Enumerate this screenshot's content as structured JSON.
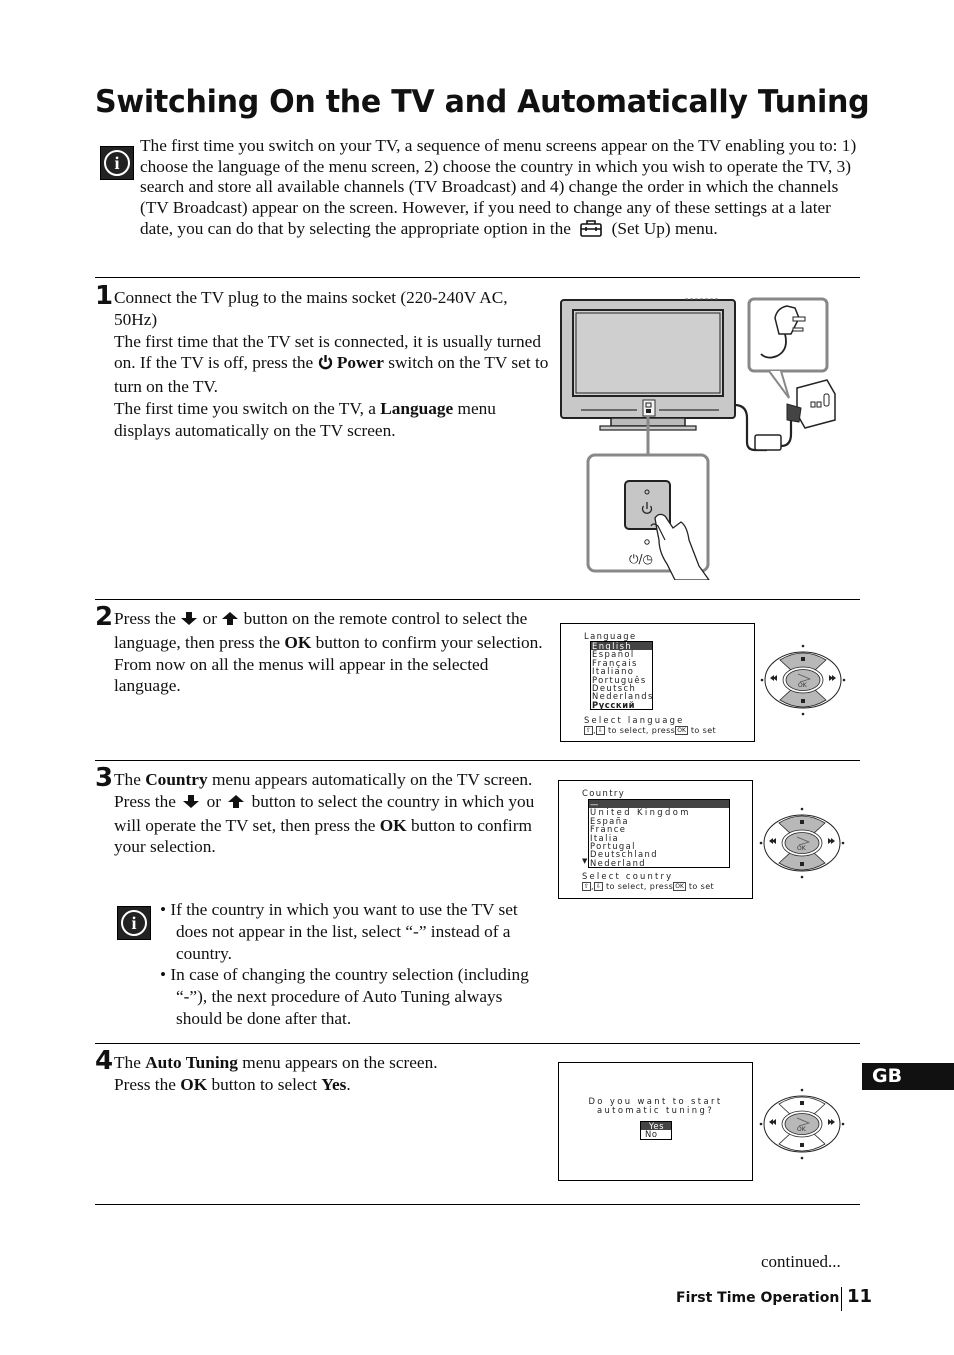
{
  "title": "Switching On the TV and Automatically Tuning",
  "intro": {
    "icon": "info-icon",
    "text_before_icon": "The first time you switch on your TV, a sequence of menu screens appear on the TV enabling you to: 1) choose the language of the menu screen, 2) choose the country in which you wish to operate the TV, 3) search and store all available channels (TV Broadcast) and 4) change the order in which the channels (TV Broadcast) appear on the screen. However, if you need to change any of these settings at a later date, you can do that by selecting the appropriate option in the",
    "setup_icon": "toolbox-icon",
    "text_after_icon": "(Set Up) menu."
  },
  "steps": [
    {
      "number": "1",
      "lines": {
        "a": "Connect the TV plug to the mains socket (220-240V AC, 50Hz)",
        "b1": "The first time that the TV set is connected, it is usually turned on. If the TV is off, press the",
        "b_bold": "Power",
        "b2": "switch on the TV set to turn on the TV.",
        "c1": "The first time you switch on the TV, a",
        "c_bold": "Language",
        "c2": "menu displays automatically on the TV screen."
      },
      "illustration": {
        "description": "TV set connected to mains socket, inset showing power switch being pressed",
        "standby_label": "⏻/◷"
      }
    },
    {
      "number": "2",
      "lines": {
        "a1": "Press the",
        "a_or": "or",
        "a2": "button on the remote control to select the language, then press the",
        "a_bold": "OK",
        "a3": "button to confirm your selection.",
        "b": "From now on all the menus will appear in the selected language."
      },
      "screen": {
        "heading": "Language",
        "options": [
          "English",
          "Español",
          "Français",
          "Italiano",
          "Português",
          "Deutsch",
          "Nederlands",
          "Русский"
        ],
        "selected_index": 0,
        "prompt": "Select language",
        "hint_mid": "to select, press",
        "hint_ok": "OK",
        "hint_end": "to set"
      },
      "remote_highlight": "up-down"
    },
    {
      "number": "3",
      "lines": {
        "a1": "The",
        "a_bold": "Country",
        "a2": "menu appears automatically on the TV screen.",
        "b1": "Press the",
        "b_or": "or",
        "b2": "button to select the country in which you will operate the TV set, then press the",
        "b_bold": "OK",
        "b3": "button to confirm your selection."
      },
      "notes": [
        "If the country in which you want to use the TV set does not appear in the list, select “-” instead of a country.",
        "In case of changing the country selection (including “-”), the next procedure of Auto Tuning always should be done after that."
      ],
      "screen": {
        "heading": "Country",
        "options": [
          "—",
          "United Kingdom",
          "España",
          "France",
          "Italia",
          "Portugal",
          "Deutschland",
          "Nederland"
        ],
        "selected_index": 0,
        "prompt": "Select country",
        "hint_mid": "to select, press",
        "hint_ok": "OK",
        "hint_end": "to set"
      },
      "remote_highlight": "up-down"
    },
    {
      "number": "4",
      "lines": {
        "a1": "The",
        "a_bold": "Auto Tuning",
        "a2": "menu appears on the screen.",
        "b1": "Press the",
        "b_bold": "OK",
        "b2": "button to select",
        "b_bold2": "Yes",
        "b3": "."
      },
      "screen": {
        "question_line1": "Do you want to start",
        "question_line2": "automatic tuning?",
        "options": [
          "Yes",
          "No"
        ],
        "selected_index": 0
      },
      "remote_highlight": "ok"
    }
  ],
  "remote": {
    "ok_label": "OK"
  },
  "language_tab": "GB",
  "continued": "continued...",
  "footer": {
    "section": "First Time Operation",
    "page": "11"
  }
}
